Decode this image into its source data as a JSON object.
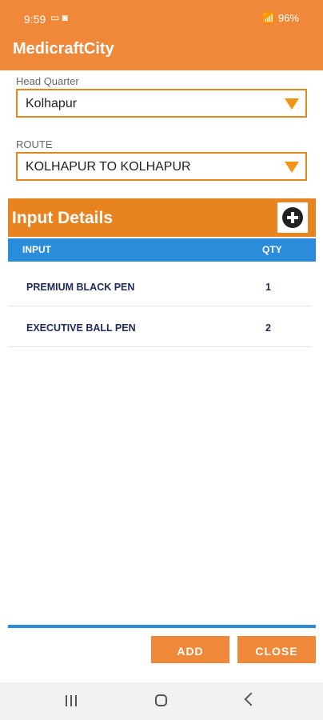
{
  "status": {
    "time": "9:59",
    "left_icons": "▭ ◙",
    "right_text": "📶 96%"
  },
  "app": {
    "title": "MedicraftCity"
  },
  "form": {
    "hq_label": "Head Quarter",
    "hq_value": "Kolhapur",
    "route_label": "ROUTE",
    "route_value": "KOLHAPUR TO KOLHAPUR"
  },
  "section": {
    "title": "Input Details"
  },
  "table": {
    "headers": {
      "input": "INPUT",
      "qty": "QTY"
    },
    "rows": [
      {
        "input": "PREMIUM BLACK PEN",
        "qty": "1"
      },
      {
        "input": "EXECUTIVE BALL PEN",
        "qty": "2"
      }
    ]
  },
  "actions": {
    "add": "ADD",
    "close": "CLOSE"
  },
  "colors": {
    "accent": "#f0883a",
    "header_blue": "#2a8cdb",
    "section_orange": "#e88420"
  }
}
